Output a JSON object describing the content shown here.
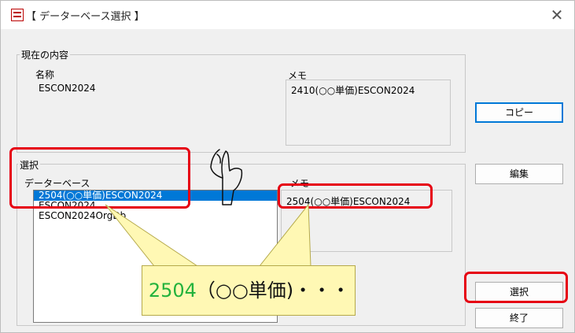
{
  "window": {
    "title": "【 データーベース選択 】",
    "close_symbol": "✕"
  },
  "current": {
    "group_label": "現在の内容",
    "name_label": "名称",
    "name_value": "ESCON2024",
    "memo_label": "メモ",
    "memo_value": "2410(○○単価)ESCON2024"
  },
  "select": {
    "group_label": "選択",
    "database_label": "データーベース",
    "memo_label": "メモ",
    "memo_value": "2504(○○単価)ESCON2024",
    "list": [
      "2504(○○単価)ESCON2024",
      "ESCON2024",
      "ESCON2024OrgDb"
    ],
    "selected_index": 0
  },
  "buttons": {
    "copy": "コピー",
    "edit": "編集",
    "select": "選択",
    "exit": "終了"
  },
  "callout": {
    "number": "2504",
    "rest": "（○○単価)・・・"
  },
  "colors": {
    "accent": "#0078d7",
    "highlight_red": "#e60012",
    "callout_bg": "#fff8b4",
    "callout_number": "#23b23c"
  },
  "icons": [
    "app-icon",
    "close-icon",
    "pointing-hand-icon"
  ]
}
